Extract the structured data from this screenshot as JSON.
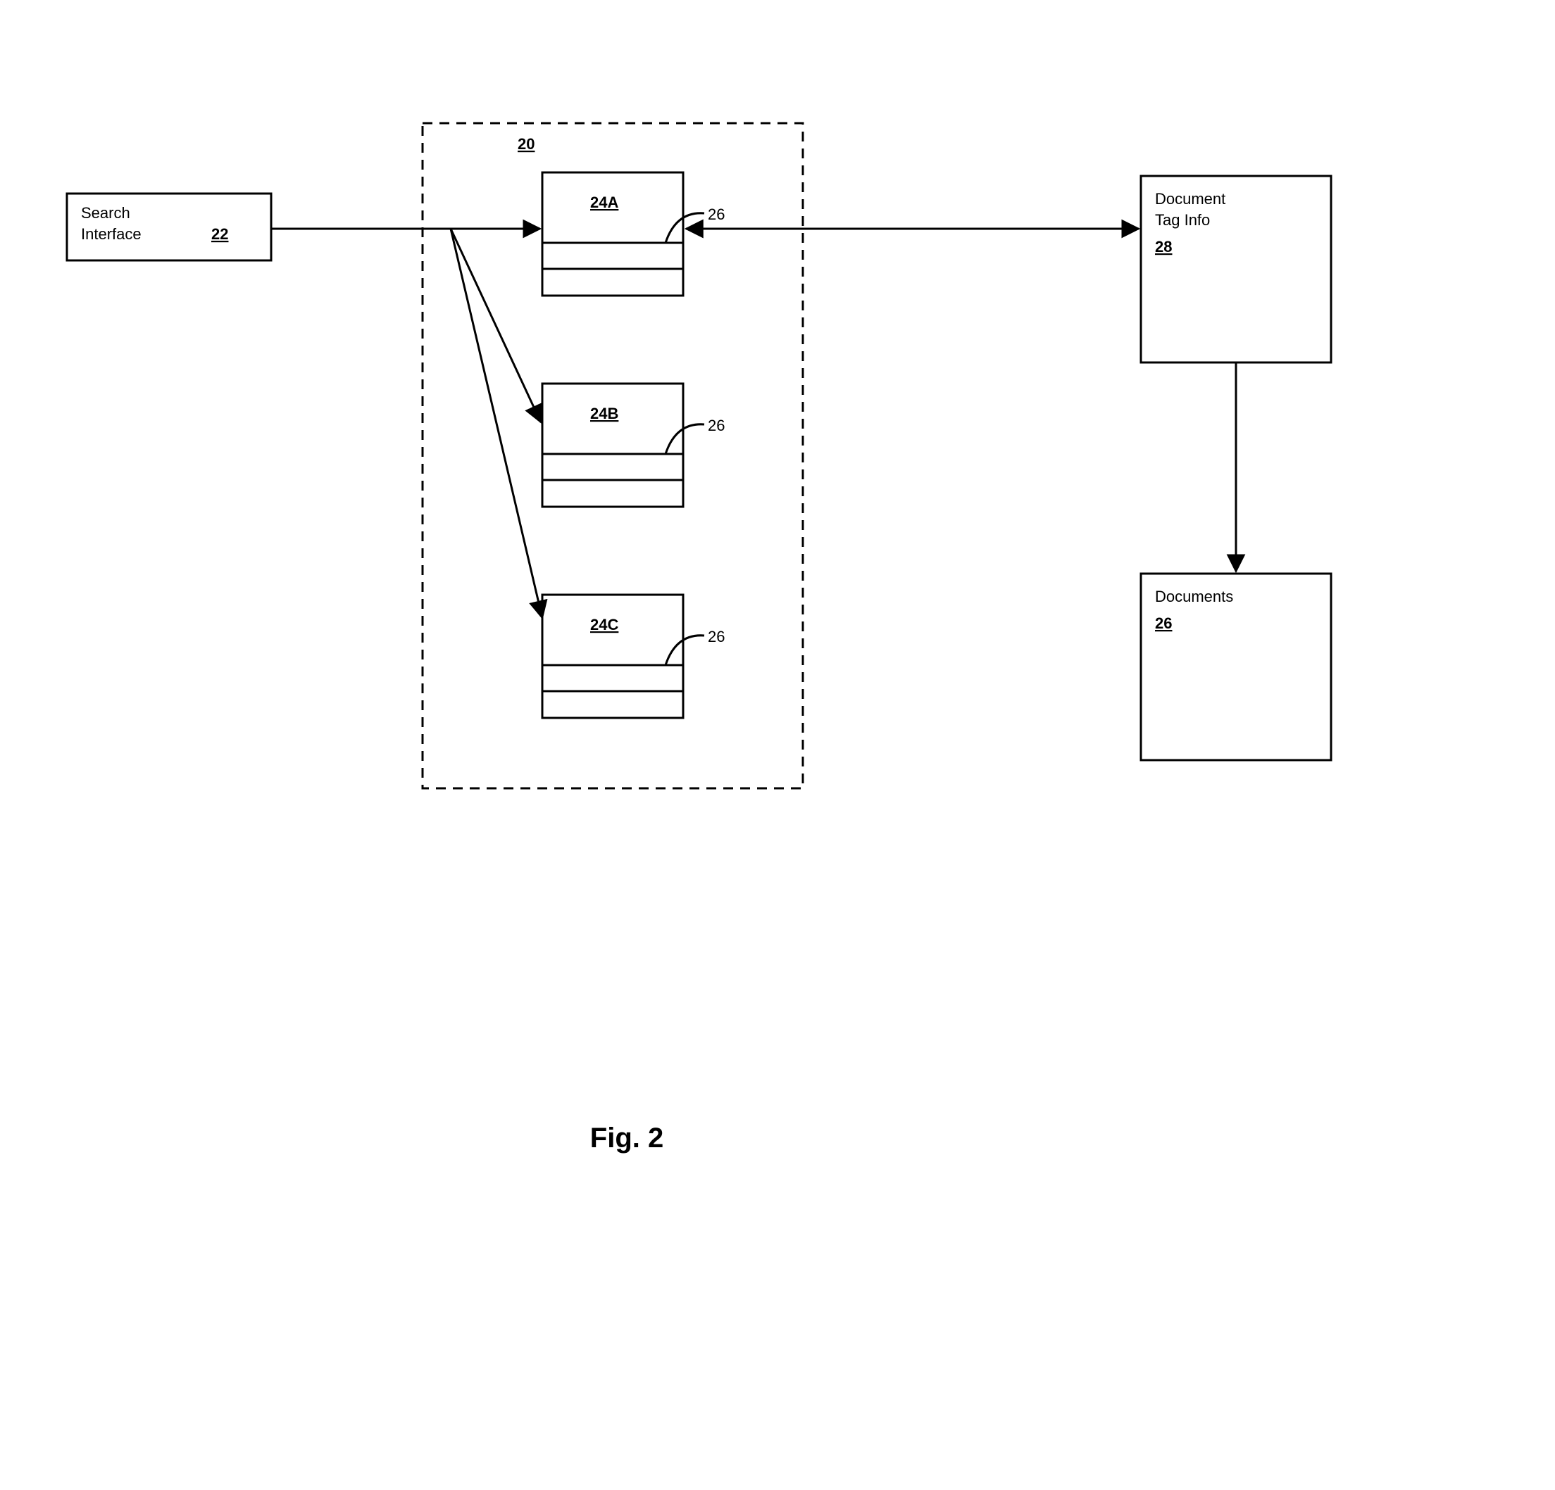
{
  "figure": {
    "title": "Fig. 2"
  },
  "search_interface": {
    "line1": "Search",
    "line2": "Interface",
    "ref": "22"
  },
  "container": {
    "ref": "20"
  },
  "indices": {
    "a": {
      "ref": "24A",
      "callout": "26"
    },
    "b": {
      "ref": "24B",
      "callout": "26"
    },
    "c": {
      "ref": "24C",
      "callout": "26"
    }
  },
  "doc_tag_info": {
    "line1": "Document",
    "line2": "Tag Info",
    "ref": "28"
  },
  "documents": {
    "label": "Documents",
    "ref": "26"
  }
}
